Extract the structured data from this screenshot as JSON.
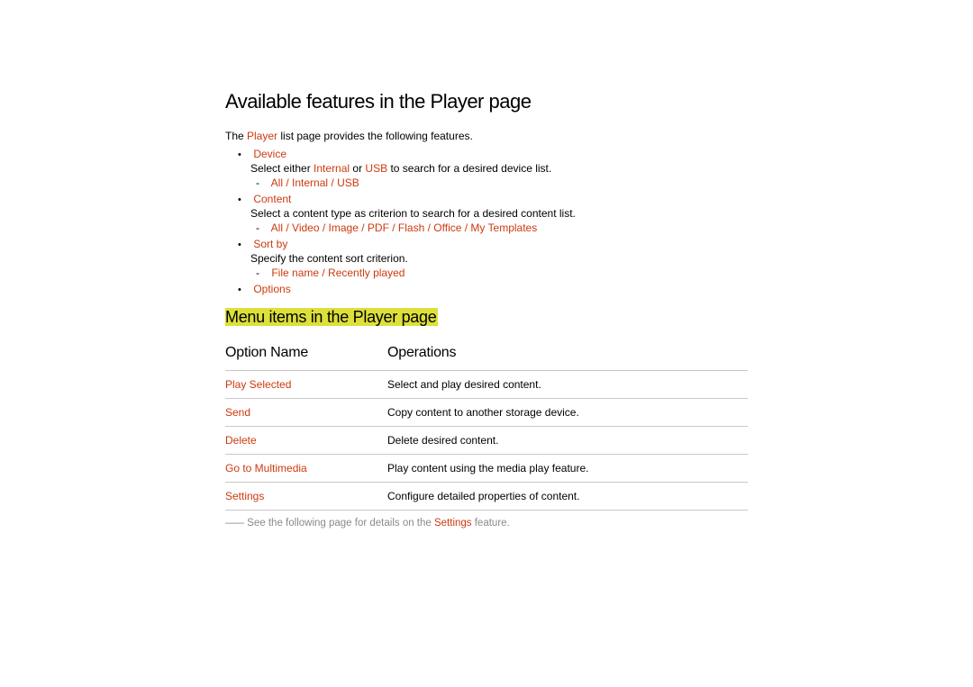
{
  "title": "Available features in the Player page",
  "intro_before": "The ",
  "intro_player": "Player",
  "intro_after": " list page provides the following features.",
  "features": [
    {
      "label": "Device",
      "desc_parts": [
        "Select either ",
        "Internal",
        " or ",
        "USB",
        " to search for a desired device list."
      ],
      "options": [
        "All",
        "Internal",
        "USB"
      ]
    },
    {
      "label": "Content",
      "desc_parts": [
        "Select a content type as criterion to search for a desired content list."
      ],
      "options": [
        "All",
        "Video",
        "Image",
        "PDF",
        "Flash",
        "Office",
        "My Templates"
      ]
    },
    {
      "label": "Sort by",
      "desc_parts": [
        "Specify the content sort criterion."
      ],
      "options": [
        "File name",
        "Recently played"
      ]
    },
    {
      "label": "Options",
      "desc_parts": [],
      "options": []
    }
  ],
  "subheading": "Menu items in the Player page",
  "table": {
    "header_option": "Option Name",
    "header_ops": "Operations",
    "rows": [
      {
        "name": "Play Selected",
        "op": "Select and play desired content."
      },
      {
        "name": "Send",
        "op": "Copy content to another storage device."
      },
      {
        "name": "Delete",
        "op": "Delete desired content."
      },
      {
        "name": "Go to Multimedia",
        "op": "Play content using the media play feature."
      },
      {
        "name": "Settings",
        "op": "Configure detailed properties of content."
      }
    ]
  },
  "footnote_before": "See the following page for details on the ",
  "footnote_settings": "Settings",
  "footnote_after": " feature."
}
